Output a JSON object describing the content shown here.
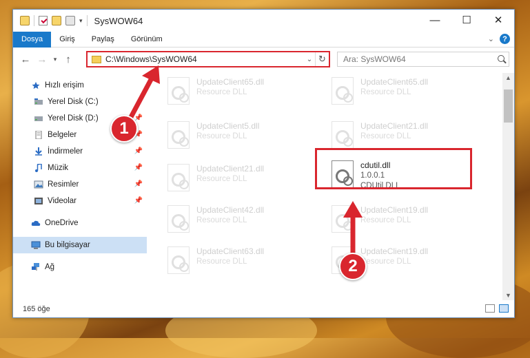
{
  "window": {
    "title": "SysWOW64",
    "controls": {
      "minimize": "—",
      "maximize": "☐",
      "close": "✕"
    }
  },
  "ribbon": {
    "tabs": [
      {
        "label": "Dosya",
        "active": true
      },
      {
        "label": "Giriş",
        "active": false
      },
      {
        "label": "Paylaş",
        "active": false
      },
      {
        "label": "Görünüm",
        "active": false
      }
    ]
  },
  "nav": {
    "address": "C:\\Windows\\SysWOW64",
    "search_placeholder": "Ara: SysWOW64"
  },
  "sidebar": {
    "items": [
      {
        "label": "Hızlı erişim",
        "icon": "star-icon",
        "pinned": false
      },
      {
        "label": "Yerel Disk (C:)",
        "icon": "drive-icon",
        "pinned": false
      },
      {
        "label": "Yerel Disk (D:)",
        "icon": "drive-icon",
        "pinned": true
      },
      {
        "label": "Belgeler",
        "icon": "documents-icon",
        "pinned": true
      },
      {
        "label": "İndirmeler",
        "icon": "download-icon",
        "pinned": true
      },
      {
        "label": "Müzik",
        "icon": "music-icon",
        "pinned": true
      },
      {
        "label": "Resimler",
        "icon": "pictures-icon",
        "pinned": true
      },
      {
        "label": "Videolar",
        "icon": "videos-icon",
        "pinned": true
      },
      {
        "label": "OneDrive",
        "icon": "cloud-icon",
        "pinned": false
      },
      {
        "label": "Bu bilgisayar",
        "icon": "computer-icon",
        "pinned": false,
        "selected": true
      },
      {
        "label": "Ağ",
        "icon": "network-icon",
        "pinned": false
      }
    ]
  },
  "files": [
    {
      "name": "UpdateClient65.dll",
      "type": "Resource DLL"
    },
    {
      "name": "UpdateClient65.dll",
      "type": "Resource DLL"
    },
    {
      "name": "UpdateClient5.dll",
      "type": "Resource DLL"
    },
    {
      "name": "UpdateClient21.dll",
      "type": "Resource DLL"
    },
    {
      "name": "UpdateClient21.dll",
      "type": "Resource DLL"
    },
    {
      "name": "cdutil.dll",
      "version": "1.0.0.1",
      "type": "CDUtil DLL",
      "highlighted": true
    },
    {
      "name": "UpdateClient42.dll",
      "type": "Resource DLL"
    },
    {
      "name": "UpdateClient19.dll",
      "type": "Resource DLL"
    },
    {
      "name": "UpdateClient63.dll",
      "type": "Resource DLL"
    },
    {
      "name": "UpdateClient19.dll",
      "type": "Resource DLL"
    }
  ],
  "status": {
    "count": "165 öğe"
  },
  "callouts": [
    "1",
    "2"
  ],
  "colors": {
    "accent": "#1979ca",
    "highlight": "#d9262e"
  }
}
